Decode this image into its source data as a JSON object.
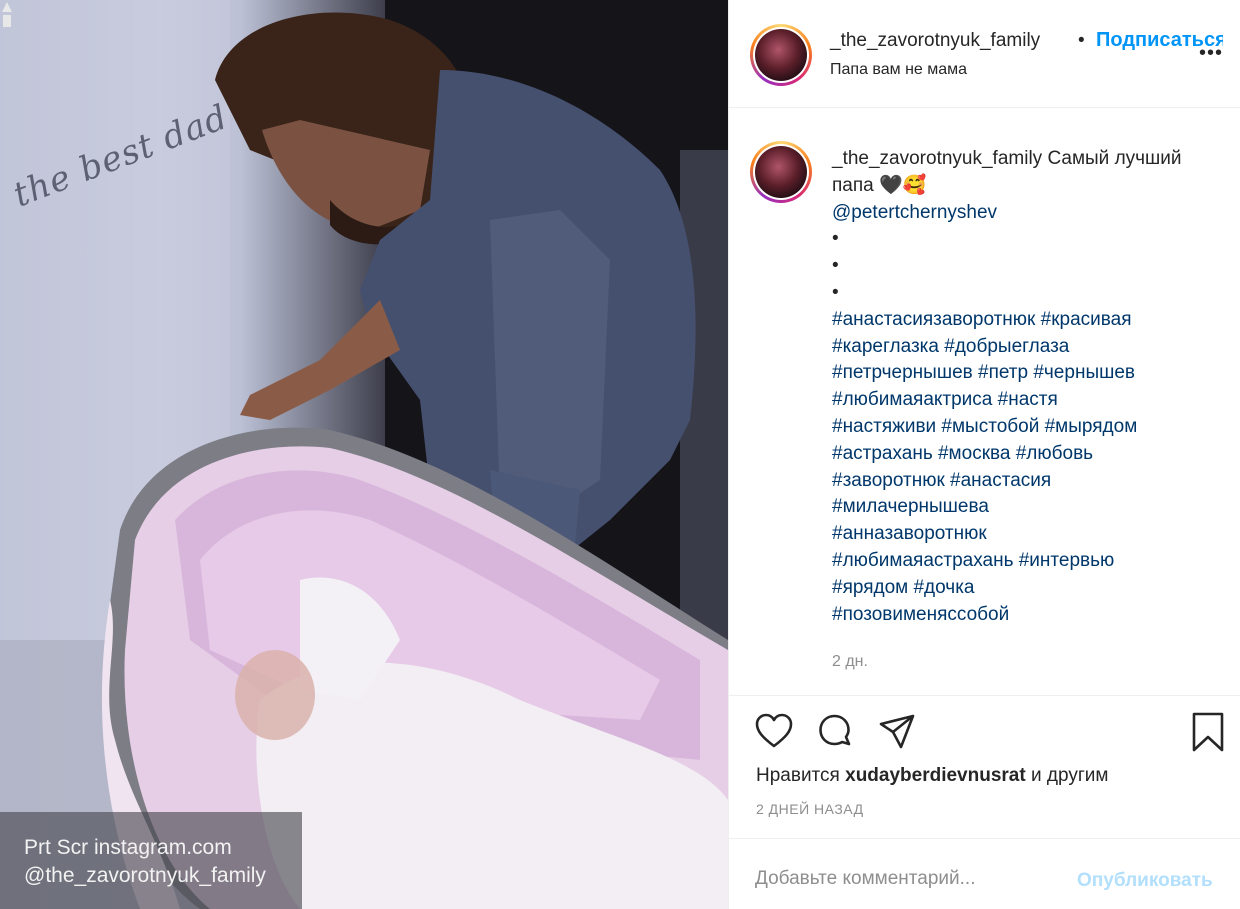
{
  "photo": {
    "overlay_text": "the best dad",
    "watermark_line1": "Prt Scr instagram.com",
    "watermark_line2": "@the_zavorotnyuk_family"
  },
  "header": {
    "username": "_the_zavorotnyuk_family",
    "dot": "•",
    "follow_label": "Подписаться",
    "location": "Папа вам не мама",
    "more": "•••"
  },
  "caption": {
    "username": "_the_zavorotnyuk_family",
    "text": "Самый лучший папа 🖤🥰",
    "mention": "@petertchernyshev",
    "dots": [
      "•",
      "•",
      "•"
    ],
    "hashtag_lines": [
      "#анастасиязаворотнюк #красивая",
      "#кареглазка #добрыеглаза",
      "#петрчернышев #петр #чернышев",
      "#любимаяактриса #настя",
      "#настяживи #мыстобой #мырядом",
      "#астрахань #москва #любовь",
      "#заворотнюк #анастасия",
      "#милачернышева",
      "#анназаворотнюк",
      "#любимаяастрахань #интервью",
      "#ярядом #дочка",
      "#позовименяссобой"
    ],
    "time": "2 дн."
  },
  "actions": {
    "icons": [
      "heart-icon",
      "comment-icon",
      "share-icon",
      "bookmark-icon"
    ],
    "likes_prefix": "Нравится",
    "likes_user": "xudayberdievnusrat",
    "likes_suffix": "и другим",
    "date": "2 ДНЕЙ НАЗАД"
  },
  "comment": {
    "placeholder": "Добавьте комментарий...",
    "publish_label": "Опубликовать"
  },
  "colors": {
    "link_blue": "#0095f6",
    "hashtag": "#00376b",
    "muted": "#8e8e8e",
    "publish_disabled": "#b2dffc"
  }
}
